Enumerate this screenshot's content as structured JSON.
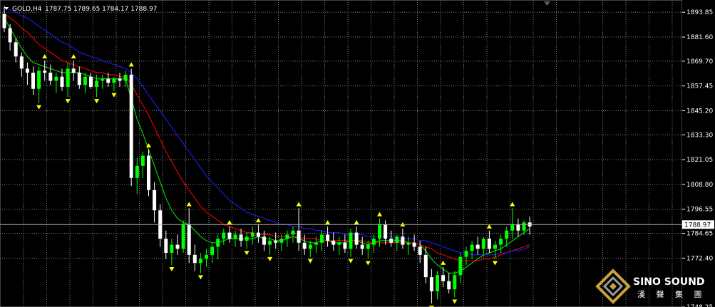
{
  "header": {
    "symbol": "GOLD,H4",
    "ohlc": "1787.75 1789.65 1784.17 1788.97"
  },
  "logo": {
    "line1": "SINO SOUND",
    "line2": "漢 聲 集 團"
  },
  "colors": {
    "background": "#000000",
    "grid": "#7f7f7f",
    "bull": "#00ff00",
    "bear": "#ffffff",
    "ma_fast": "#00d000",
    "ma_mid": "#e00000",
    "ma_slow": "#1a1ae6",
    "fractal": "#ffff00",
    "axis_text": "#ffffff"
  },
  "chart_data": {
    "type": "candlestick",
    "title": "GOLD,H4",
    "ylim": [
      1748.25,
      1899.9
    ],
    "current_price": "1788.97",
    "y_ticks": [
      "1893.85",
      "1881.60",
      "1869.70",
      "1857.45",
      "1845.20",
      "1833.30",
      "1821.05",
      "1808.80",
      "1796.55",
      "1784.65",
      "1772.40",
      "1748.25"
    ],
    "candles": [
      [
        1893,
        1897,
        1884,
        1886
      ],
      [
        1886,
        1888,
        1875,
        1879
      ],
      [
        1879,
        1881,
        1869,
        1872
      ],
      [
        1872,
        1874,
        1862,
        1866
      ],
      [
        1866,
        1869,
        1858,
        1864
      ],
      [
        1864,
        1867,
        1853,
        1856
      ],
      [
        1856,
        1867,
        1849,
        1865
      ],
      [
        1865,
        1870,
        1860,
        1864
      ],
      [
        1864,
        1868,
        1858,
        1860
      ],
      [
        1860,
        1864,
        1854,
        1862
      ],
      [
        1862,
        1866,
        1855,
        1857
      ],
      [
        1857,
        1869,
        1852,
        1866
      ],
      [
        1866,
        1870,
        1860,
        1864
      ],
      [
        1864,
        1867,
        1856,
        1858
      ],
      [
        1858,
        1864,
        1854,
        1862
      ],
      [
        1862,
        1864,
        1856,
        1857
      ],
      [
        1857,
        1863,
        1852,
        1860
      ],
      [
        1860,
        1863,
        1856,
        1861
      ],
      [
        1861,
        1864,
        1857,
        1859
      ],
      [
        1859,
        1862,
        1855,
        1861
      ],
      [
        1861,
        1864,
        1857,
        1860
      ],
      [
        1860,
        1865,
        1857,
        1863
      ],
      [
        1863,
        1866,
        1808,
        1812
      ],
      [
        1812,
        1822,
        1804,
        1818
      ],
      [
        1818,
        1825,
        1812,
        1823
      ],
      [
        1823,
        1826,
        1803,
        1806
      ],
      [
        1806,
        1810,
        1790,
        1796
      ],
      [
        1796,
        1799,
        1778,
        1782
      ],
      [
        1782,
        1786,
        1772,
        1775
      ],
      [
        1775,
        1782,
        1769,
        1779
      ],
      [
        1779,
        1784,
        1774,
        1777
      ],
      [
        1777,
        1791,
        1775,
        1789
      ],
      [
        1789,
        1797,
        1770,
        1774
      ],
      [
        1774,
        1779,
        1766,
        1770
      ],
      [
        1770,
        1775,
        1765,
        1772
      ],
      [
        1772,
        1777,
        1768,
        1774
      ],
      [
        1774,
        1780,
        1770,
        1778
      ],
      [
        1778,
        1784,
        1772,
        1782
      ],
      [
        1782,
        1787,
        1779,
        1785
      ],
      [
        1785,
        1788,
        1780,
        1782
      ],
      [
        1782,
        1786,
        1778,
        1784
      ],
      [
        1784,
        1787,
        1778,
        1781
      ],
      [
        1781,
        1785,
        1777,
        1783
      ],
      [
        1783,
        1788,
        1779,
        1785
      ],
      [
        1785,
        1789,
        1780,
        1783
      ],
      [
        1783,
        1786,
        1776,
        1779
      ],
      [
        1779,
        1783,
        1774,
        1781
      ],
      [
        1781,
        1785,
        1777,
        1780
      ],
      [
        1780,
        1784,
        1776,
        1782
      ],
      [
        1782,
        1786,
        1778,
        1784
      ],
      [
        1784,
        1788,
        1780,
        1786
      ],
      [
        1786,
        1797,
        1776,
        1780
      ],
      [
        1780,
        1784,
        1774,
        1777
      ],
      [
        1777,
        1781,
        1773,
        1779
      ],
      [
        1779,
        1783,
        1775,
        1780
      ],
      [
        1780,
        1786,
        1776,
        1784
      ],
      [
        1784,
        1788,
        1778,
        1781
      ],
      [
        1781,
        1785,
        1776,
        1779
      ],
      [
        1779,
        1783,
        1774,
        1780
      ],
      [
        1780,
        1784,
        1775,
        1777
      ],
      [
        1777,
        1787,
        1773,
        1785
      ],
      [
        1785,
        1788,
        1777,
        1779
      ],
      [
        1779,
        1783,
        1774,
        1777
      ],
      [
        1777,
        1781,
        1772,
        1779
      ],
      [
        1779,
        1784,
        1775,
        1782
      ],
      [
        1782,
        1792,
        1778,
        1789
      ],
      [
        1789,
        1791,
        1779,
        1782
      ],
      [
        1782,
        1786,
        1778,
        1780
      ],
      [
        1780,
        1784,
        1776,
        1783
      ],
      [
        1783,
        1787,
        1777,
        1779
      ],
      [
        1779,
        1783,
        1774,
        1780
      ],
      [
        1780,
        1784,
        1776,
        1778
      ],
      [
        1778,
        1781,
        1770,
        1774
      ],
      [
        1774,
        1778,
        1760,
        1763
      ],
      [
        1763,
        1767,
        1750,
        1756
      ],
      [
        1756,
        1766,
        1752,
        1764
      ],
      [
        1764,
        1768,
        1758,
        1761
      ],
      [
        1761,
        1765,
        1755,
        1757
      ],
      [
        1757,
        1766,
        1753,
        1764
      ],
      [
        1764,
        1775,
        1760,
        1773
      ],
      [
        1773,
        1778,
        1769,
        1776
      ],
      [
        1776,
        1781,
        1772,
        1779
      ],
      [
        1779,
        1783,
        1774,
        1777
      ],
      [
        1777,
        1783,
        1773,
        1782
      ],
      [
        1782,
        1786,
        1775,
        1777
      ],
      [
        1777,
        1781,
        1772,
        1779
      ],
      [
        1779,
        1784,
        1775,
        1782
      ],
      [
        1782,
        1788,
        1778,
        1786
      ],
      [
        1786,
        1797,
        1782,
        1789
      ],
      [
        1789,
        1792,
        1783,
        1786
      ],
      [
        1786,
        1791,
        1784,
        1790
      ],
      [
        1790,
        1793,
        1784,
        1788
      ]
    ],
    "ma_fast": [
      1891,
      1886,
      1881,
      1876,
      1872,
      1869,
      1868,
      1867,
      1866,
      1865,
      1864,
      1864,
      1864,
      1864,
      1863,
      1862,
      1861,
      1861,
      1861,
      1861,
      1861,
      1861,
      1851,
      1841,
      1834,
      1826,
      1818,
      1810,
      1802,
      1796,
      1792,
      1790,
      1789,
      1786,
      1783,
      1781,
      1780,
      1780,
      1781,
      1782,
      1782,
      1782,
      1782,
      1782,
      1783,
      1782,
      1782,
      1781,
      1781,
      1782,
      1783,
      1782,
      1781,
      1780,
      1780,
      1781,
      1781,
      1780,
      1780,
      1780,
      1781,
      1781,
      1780,
      1779,
      1780,
      1781,
      1781,
      1781,
      1781,
      1781,
      1780,
      1780,
      1779,
      1776,
      1772,
      1769,
      1767,
      1765,
      1765,
      1766,
      1768,
      1770,
      1772,
      1774,
      1775,
      1776,
      1777,
      1779,
      1781,
      1783,
      1785,
      1787
    ],
    "ma_mid": [
      1893,
      1891,
      1889,
      1886,
      1884,
      1881,
      1878,
      1876,
      1874,
      1872,
      1870,
      1869,
      1868,
      1867,
      1866,
      1865,
      1864,
      1864,
      1863,
      1863,
      1862,
      1862,
      1858,
      1853,
      1848,
      1843,
      1837,
      1831,
      1825,
      1820,
      1815,
      1810,
      1806,
      1802,
      1798,
      1795,
      1793,
      1791,
      1789,
      1788,
      1787,
      1786,
      1785,
      1785,
      1784,
      1784,
      1784,
      1783,
      1783,
      1783,
      1783,
      1783,
      1782,
      1782,
      1782,
      1781,
      1781,
      1781,
      1781,
      1781,
      1781,
      1781,
      1781,
      1780,
      1780,
      1780,
      1780,
      1780,
      1780,
      1780,
      1780,
      1780,
      1779,
      1778,
      1777,
      1775,
      1774,
      1773,
      1772,
      1771,
      1771,
      1771,
      1771,
      1772,
      1772,
      1773,
      1774,
      1775,
      1776,
      1777,
      1778,
      1779
    ],
    "ma_slow": [
      1896,
      1895,
      1894,
      1892,
      1891,
      1889,
      1887,
      1885,
      1883,
      1881,
      1879,
      1878,
      1876,
      1874,
      1873,
      1872,
      1871,
      1870,
      1869,
      1868,
      1867,
      1866,
      1864,
      1861,
      1857,
      1853,
      1849,
      1845,
      1841,
      1837,
      1833,
      1829,
      1825,
      1821,
      1817,
      1813,
      1810,
      1807,
      1804,
      1801,
      1799,
      1797,
      1795,
      1794,
      1793,
      1792,
      1791,
      1790,
      1789,
      1789,
      1788,
      1788,
      1787,
      1787,
      1786,
      1786,
      1785,
      1785,
      1785,
      1784,
      1784,
      1784,
      1784,
      1783,
      1783,
      1783,
      1783,
      1783,
      1782,
      1782,
      1782,
      1782,
      1781,
      1781,
      1780,
      1779,
      1778,
      1777,
      1776,
      1775,
      1775,
      1774,
      1774,
      1774,
      1774,
      1774,
      1775,
      1775,
      1776,
      1776,
      1777,
      1778
    ]
  }
}
